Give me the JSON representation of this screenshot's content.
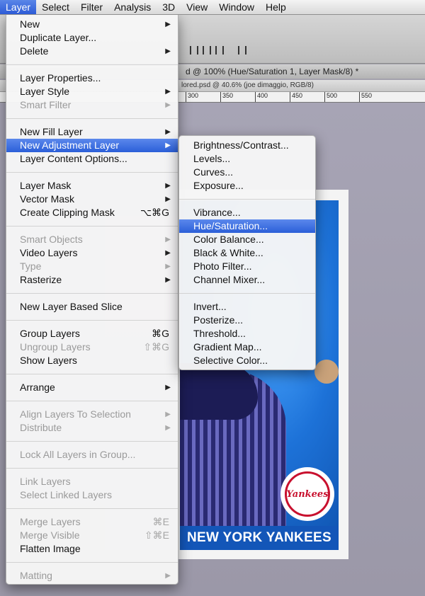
{
  "menubar": {
    "items": [
      {
        "label": "Layer",
        "active": true
      },
      {
        "label": "Select"
      },
      {
        "label": "Filter"
      },
      {
        "label": "Analysis"
      },
      {
        "label": "3D"
      },
      {
        "label": "View"
      },
      {
        "label": "Window"
      },
      {
        "label": "Help"
      }
    ]
  },
  "document": {
    "tab1": "d @ 100% (Hue/Saturation 1, Layer Mask/8) *",
    "tab2": "lored.psd @ 40.6% (joe dimaggio, RGB/8)",
    "ruler_ticks": [
      "300",
      "350",
      "400",
      "450",
      "500",
      "550"
    ]
  },
  "card": {
    "banner": "NEW YORK YANKEES",
    "logo_text": "Yankees"
  },
  "layer_menu": {
    "groups": [
      [
        {
          "label": "New",
          "submenu": true
        },
        {
          "label": "Duplicate Layer..."
        },
        {
          "label": "Delete",
          "submenu": true
        }
      ],
      [
        {
          "label": "Layer Properties..."
        },
        {
          "label": "Layer Style",
          "submenu": true
        },
        {
          "label": "Smart Filter",
          "submenu": true,
          "disabled": true
        }
      ],
      [
        {
          "label": "New Fill Layer",
          "submenu": true
        },
        {
          "label": "New Adjustment Layer",
          "submenu": true,
          "highlight": true
        },
        {
          "label": "Layer Content Options..."
        }
      ],
      [
        {
          "label": "Layer Mask",
          "submenu": true
        },
        {
          "label": "Vector Mask",
          "submenu": true
        },
        {
          "label": "Create Clipping Mask",
          "shortcut": "⌥⌘G"
        }
      ],
      [
        {
          "label": "Smart Objects",
          "submenu": true,
          "disabled": true
        },
        {
          "label": "Video Layers",
          "submenu": true
        },
        {
          "label": "Type",
          "submenu": true,
          "disabled": true
        },
        {
          "label": "Rasterize",
          "submenu": true
        }
      ],
      [
        {
          "label": "New Layer Based Slice"
        }
      ],
      [
        {
          "label": "Group Layers",
          "shortcut": "⌘G"
        },
        {
          "label": "Ungroup Layers",
          "shortcut": "⇧⌘G",
          "disabled": true
        },
        {
          "label": "Show Layers"
        }
      ],
      [
        {
          "label": "Arrange",
          "submenu": true
        }
      ],
      [
        {
          "label": "Align Layers To Selection",
          "submenu": true,
          "disabled": true
        },
        {
          "label": "Distribute",
          "submenu": true,
          "disabled": true
        }
      ],
      [
        {
          "label": "Lock All Layers in Group...",
          "disabled": true
        }
      ],
      [
        {
          "label": "Link Layers",
          "disabled": true
        },
        {
          "label": "Select Linked Layers",
          "disabled": true
        }
      ],
      [
        {
          "label": "Merge Layers",
          "shortcut": "⌘E",
          "disabled": true
        },
        {
          "label": "Merge Visible",
          "shortcut": "⇧⌘E",
          "disabled": true
        },
        {
          "label": "Flatten Image"
        }
      ],
      [
        {
          "label": "Matting",
          "submenu": true,
          "disabled": true
        }
      ]
    ]
  },
  "adjustment_menu": {
    "groups": [
      [
        {
          "label": "Brightness/Contrast..."
        },
        {
          "label": "Levels..."
        },
        {
          "label": "Curves..."
        },
        {
          "label": "Exposure..."
        }
      ],
      [
        {
          "label": "Vibrance..."
        },
        {
          "label": "Hue/Saturation...",
          "highlight": true
        },
        {
          "label": "Color Balance..."
        },
        {
          "label": "Black & White..."
        },
        {
          "label": "Photo Filter..."
        },
        {
          "label": "Channel Mixer..."
        }
      ],
      [
        {
          "label": "Invert..."
        },
        {
          "label": "Posterize..."
        },
        {
          "label": "Threshold..."
        },
        {
          "label": "Gradient Map..."
        },
        {
          "label": "Selective Color..."
        }
      ]
    ]
  }
}
